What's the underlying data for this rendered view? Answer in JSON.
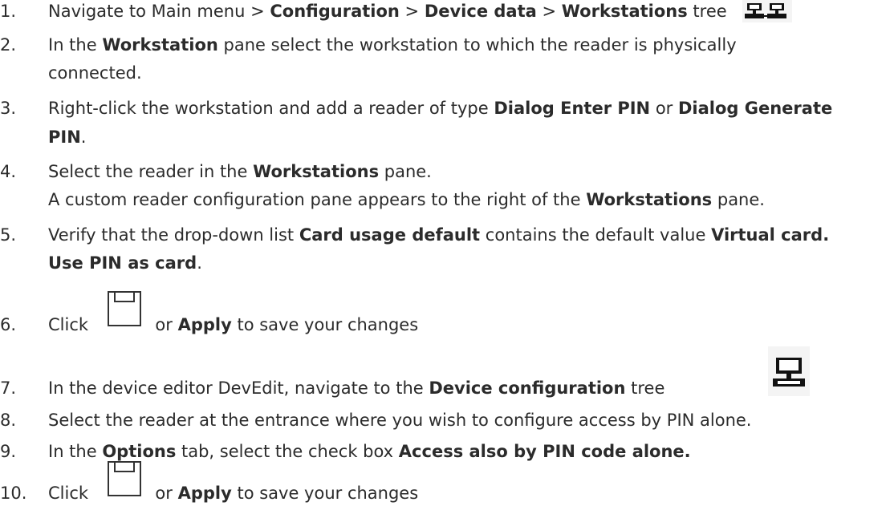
{
  "steps": [
    {
      "number": "1.",
      "parts": [
        "Navigate to Main menu > ",
        "Configuration",
        " > ",
        "Device data",
        " > ",
        "Workstations",
        " tree"
      ],
      "icon": "workstations-tree-icon"
    },
    {
      "number": "2.",
      "line1": [
        "In the ",
        "Workstation",
        " pane select the workstation to which the reader is physically"
      ],
      "line2": "connected."
    },
    {
      "number": "3.",
      "line1": [
        "Right-click the workstation and add a reader of type ",
        "Dialog Enter PIN",
        " or ",
        "Dialog Generate"
      ],
      "line2": [
        "PIN",
        "."
      ]
    },
    {
      "number": "4.",
      "line1": [
        "Select the reader in the ",
        "Workstations",
        " pane."
      ],
      "line2": [
        "A custom reader configuration pane appears to the right of the ",
        "Workstations",
        " pane."
      ]
    },
    {
      "number": "5.",
      "line1": [
        "Verify that the drop-down list ",
        "Card usage default",
        " contains the default value ",
        "Virtual card."
      ],
      "line2": [
        "Use PIN as card",
        "."
      ]
    },
    {
      "number": "6.",
      "parts": [
        "Click ",
        " or ",
        "Apply",
        " to save your changes"
      ],
      "icon": "save-icon"
    },
    {
      "number": "7.",
      "parts": [
        "In the device editor DevEdit, navigate to the ",
        "Device configuration",
        " tree"
      ],
      "icon": "device-configuration-icon"
    },
    {
      "number": "8.",
      "text": "Select the reader at the entrance where you wish to configure access by PIN alone."
    },
    {
      "number": "9.",
      "parts": [
        "In the ",
        "Options",
        " tab, select the check box ",
        "Access also by PIN code alone."
      ]
    },
    {
      "number": "10.",
      "parts": [
        "Click ",
        " or ",
        "Apply",
        " to save your changes"
      ],
      "icon": "save-icon"
    }
  ]
}
